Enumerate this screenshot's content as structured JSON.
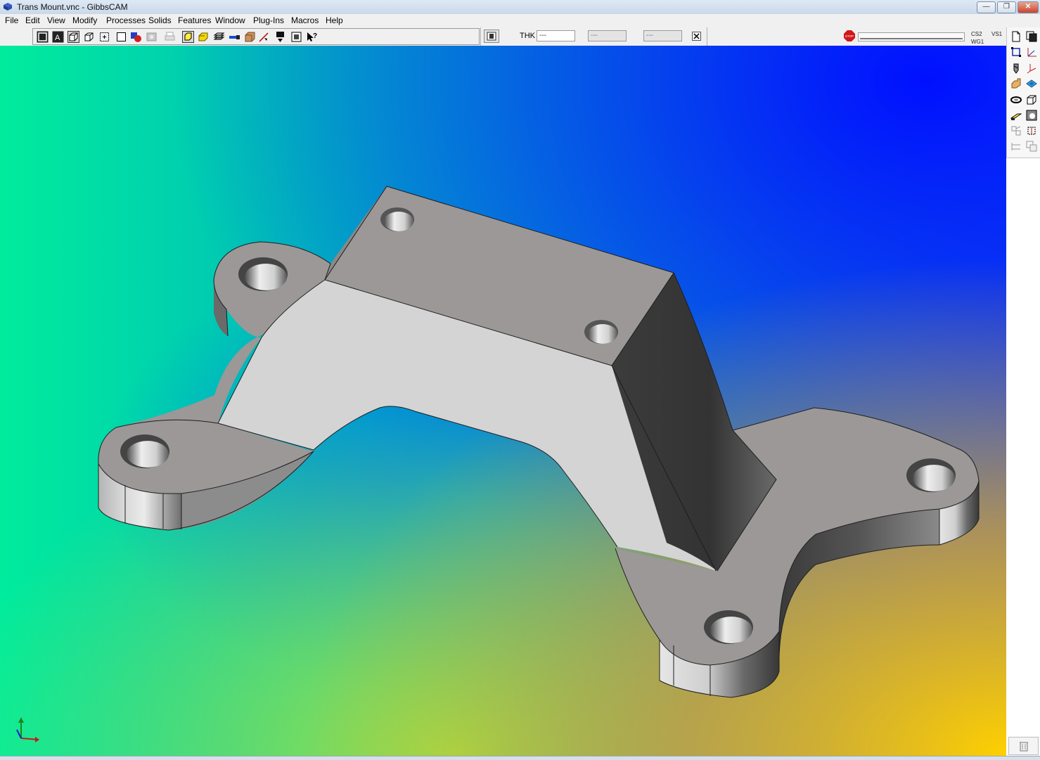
{
  "window": {
    "title": "Trans Mount.vnc - GibbsCAM"
  },
  "menu": [
    "File",
    "Edit",
    "View",
    "Modify",
    "Processes",
    "Solids",
    "Features",
    "Window",
    "Plug-Ins",
    "Macros",
    "Help"
  ],
  "thk_panel": {
    "label": "THK",
    "field1": "---",
    "field2": "---",
    "field3": "---"
  },
  "status": {
    "cs": "CS2",
    "wg": "WG1",
    "vs": "VS1",
    "stop_label": "STOP"
  },
  "toolbar_icons": [
    "wireframe-view-icon",
    "hidden-line-view-icon",
    "shaded-box-icon",
    "iso-box-icon",
    "pick-point-icon",
    "blank-square-icon",
    "color-shapes-icon",
    "gray-shape-icon",
    "printer-icon",
    "highlight-box-icon",
    "yellow-box-icon",
    "stack-icon",
    "tool-icon",
    "brown-block-icon",
    "arrow-pointer-icon",
    "arrow-down-icon",
    "window-select-icon",
    "help-pointer-icon"
  ],
  "right_panel_icons": [
    "new-document-icon",
    "copy-window-icon",
    "rectangle-select-icon",
    "axes-xyz-icon",
    "drill-bit-icon",
    "axis-tripod-icon",
    "part-shape-icon",
    "layer-icon",
    "ring-icon",
    "cube-icon",
    "blade-icon",
    "render-icon",
    "group-icon",
    "transform-icon",
    "align-icon",
    "duplicate-icon"
  ],
  "colors": {
    "gradient_left": "#00e8a0",
    "gradient_top_right": "#0010ff",
    "gradient_bottom_right": "#ffc800",
    "part_top": "#9b9897",
    "part_light": "#d4d4d4",
    "part_dark": "#3a3a3a"
  }
}
